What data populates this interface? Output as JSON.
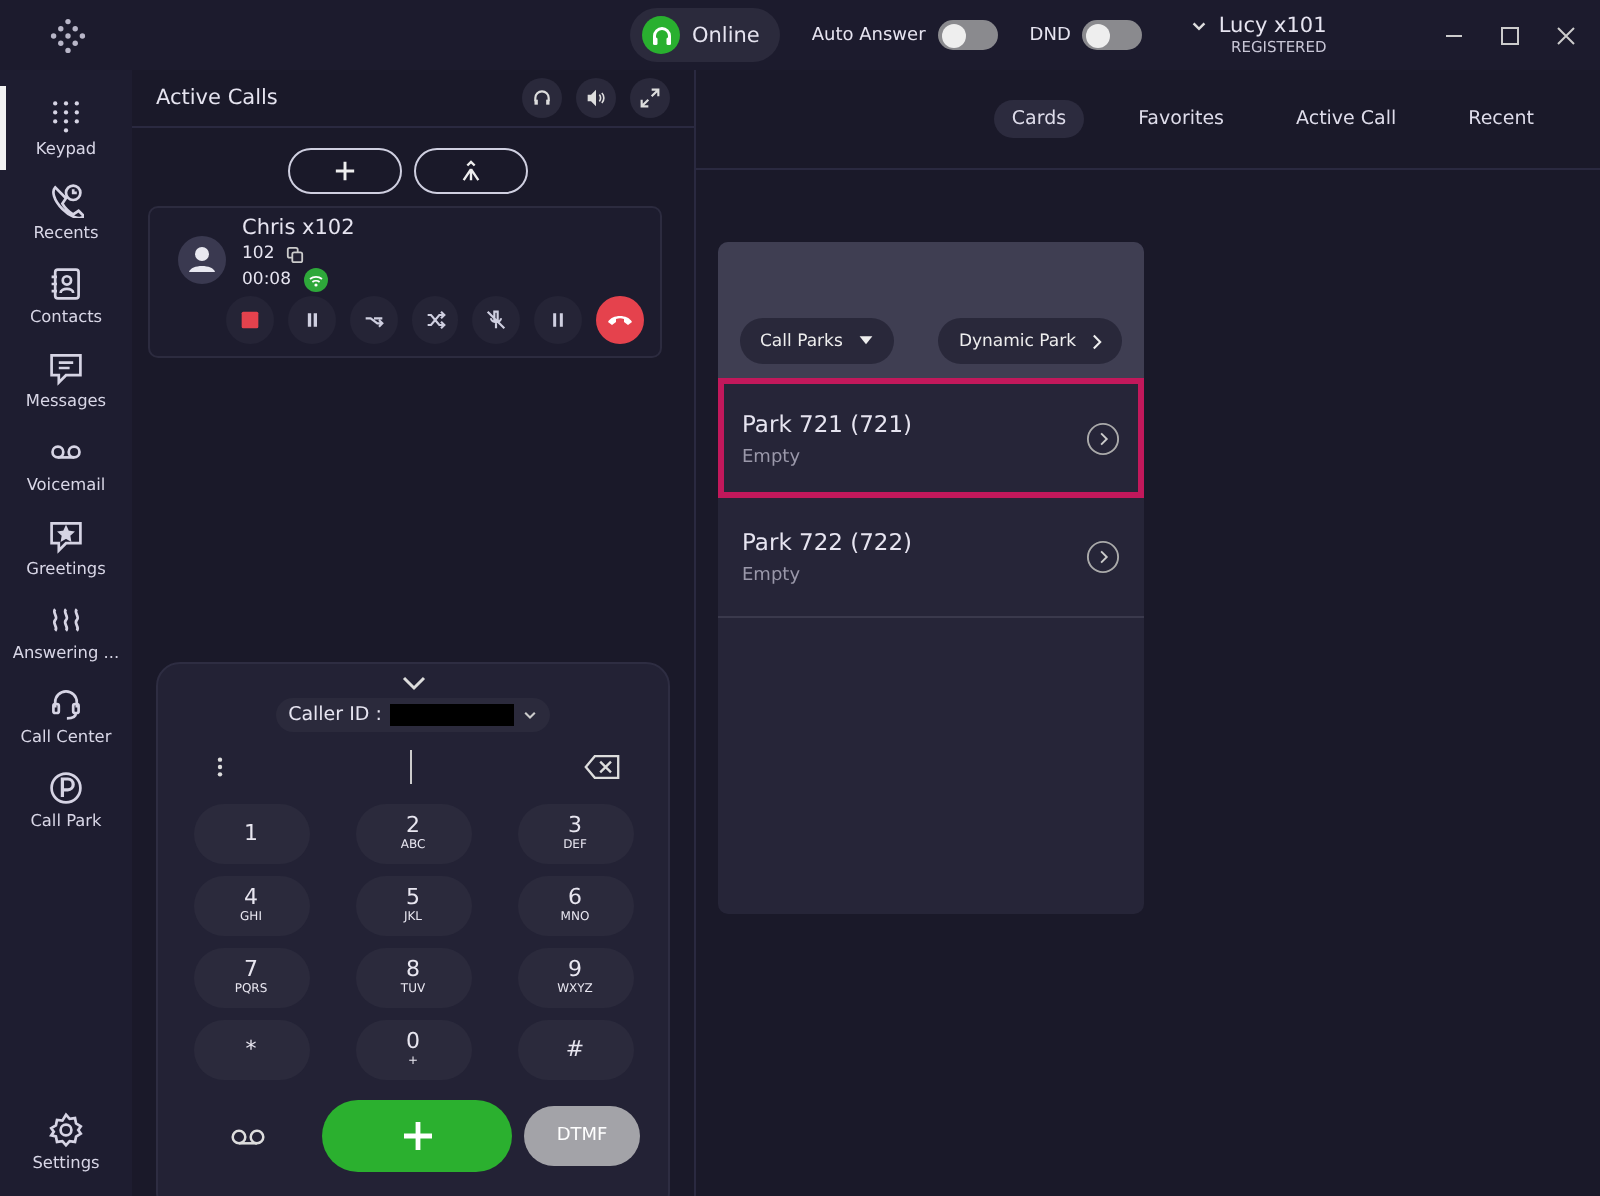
{
  "title_bar": {
    "status": {
      "label": "Online",
      "online": true
    },
    "toggles": [
      {
        "label": "Auto Answer",
        "on": false
      },
      {
        "label": "DND",
        "on": false
      }
    ],
    "user": {
      "name": "Lucy x101",
      "status": "REGISTERED"
    }
  },
  "sidebar": {
    "items": [
      {
        "label": "Keypad",
        "selected": true
      },
      {
        "label": "Recents",
        "selected": false
      },
      {
        "label": "Contacts",
        "selected": false
      },
      {
        "label": "Messages",
        "selected": false
      },
      {
        "label": "Voicemail",
        "selected": false
      },
      {
        "label": "Greetings",
        "selected": false
      },
      {
        "label": "Answering ...",
        "selected": false
      },
      {
        "label": "Call Center",
        "selected": false
      },
      {
        "label": "Call Park",
        "selected": false
      }
    ],
    "settings": "Settings"
  },
  "active_calls": {
    "title": "Active Calls",
    "calls": [
      {
        "name": "Chris x102",
        "number": "102",
        "duration": "00:08",
        "recording": true
      }
    ]
  },
  "dialpad": {
    "caller_id_label": "Caller ID :",
    "keys": [
      {
        "digit": "1"
      },
      {
        "digit": "2",
        "letters": "ABC"
      },
      {
        "digit": "3",
        "letters": "DEF"
      },
      {
        "digit": "4",
        "letters": "GHI"
      },
      {
        "digit": "5",
        "letters": "JKL"
      },
      {
        "digit": "6",
        "letters": "MNO"
      },
      {
        "digit": "7",
        "letters": "PQRS"
      },
      {
        "digit": "8",
        "letters": "TUV"
      },
      {
        "digit": "9",
        "letters": "WXYZ"
      },
      {
        "digit": "*"
      },
      {
        "digit": "0",
        "letters": "+"
      },
      {
        "digit": "#"
      }
    ],
    "dtmf": {
      "label": "DTMF",
      "disabled": true
    }
  },
  "tabs": [
    {
      "label": "Cards",
      "selected": true
    },
    {
      "label": "Favorites",
      "selected": false
    },
    {
      "label": "Active Call",
      "selected": false
    },
    {
      "label": "Recent",
      "selected": false
    }
  ],
  "park_card": {
    "dropdown": "Call Parks",
    "action": "Dynamic Park",
    "parks": [
      {
        "name": "Park 721 (721)",
        "status": "Empty",
        "selected": true
      },
      {
        "name": "Park 722 (722)",
        "status": "Empty",
        "selected": false
      }
    ]
  }
}
